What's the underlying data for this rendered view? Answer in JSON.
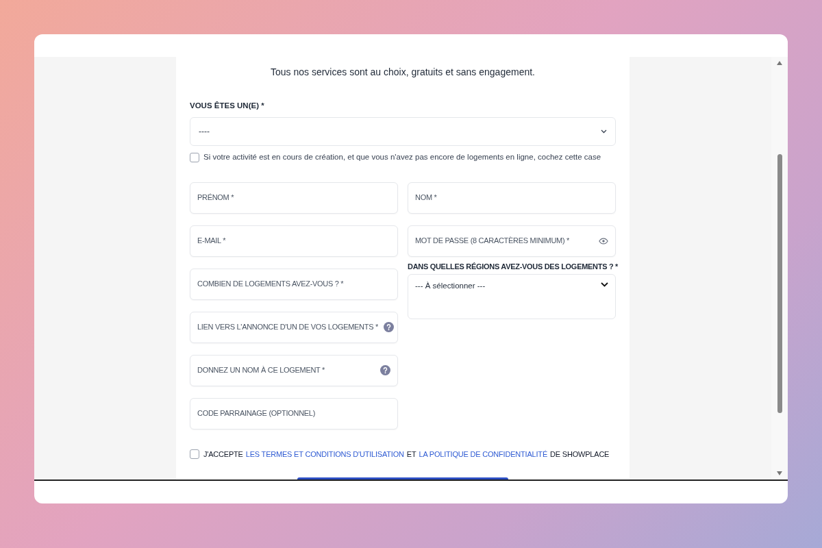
{
  "subtitle": "Tous nos services sont au choix, gratuits et sans engagement.",
  "user_type": {
    "label": "VOUS ÊTES UN(E) *",
    "value": "----"
  },
  "creation_checkbox": {
    "label": "Si votre activité est en cours de création, et que vous n'avez pas encore de logements en ligne, cochez cette case",
    "checked": false
  },
  "left_fields": [
    {
      "placeholder": "PRÉNOM *",
      "kind": "plain"
    },
    {
      "placeholder": "E-MAIL *",
      "kind": "plain"
    },
    {
      "placeholder": "COMBIEN DE LOGEMENTS AVEZ-VOUS ? *",
      "kind": "plain"
    },
    {
      "placeholder": "LIEN VERS L'ANNONCE D'UN DE VOS LOGEMENTS *",
      "kind": "help"
    },
    {
      "placeholder": "DONNEZ UN NOM À CE LOGEMENT *",
      "kind": "help"
    },
    {
      "placeholder": "CODE PARRAINAGE (OPTIONNEL)",
      "kind": "plain"
    }
  ],
  "right_fields": [
    {
      "placeholder": "NOM *",
      "kind": "plain"
    },
    {
      "placeholder": "MOT DE PASSE (8 CARACTÈRES MINIMUM) *",
      "kind": "password"
    }
  ],
  "regions": {
    "label": "DANS QUELLES RÉGIONS AVEZ-VOUS DES LOGEMENTS ? *",
    "value": "--- À sélectionner ---"
  },
  "terms": {
    "checked": false,
    "parts": [
      {
        "kind": "text",
        "text": "J'ACCEPTE"
      },
      {
        "kind": "link",
        "text": "LES TERMES ET CONDITIONS D'UTILISATION"
      },
      {
        "kind": "text",
        "text": "ET"
      },
      {
        "kind": "link",
        "text": "LA POLITIQUE DE CONFIDENTIALITÉ"
      },
      {
        "kind": "text",
        "text": "DE SHOWPLACE"
      }
    ]
  }
}
